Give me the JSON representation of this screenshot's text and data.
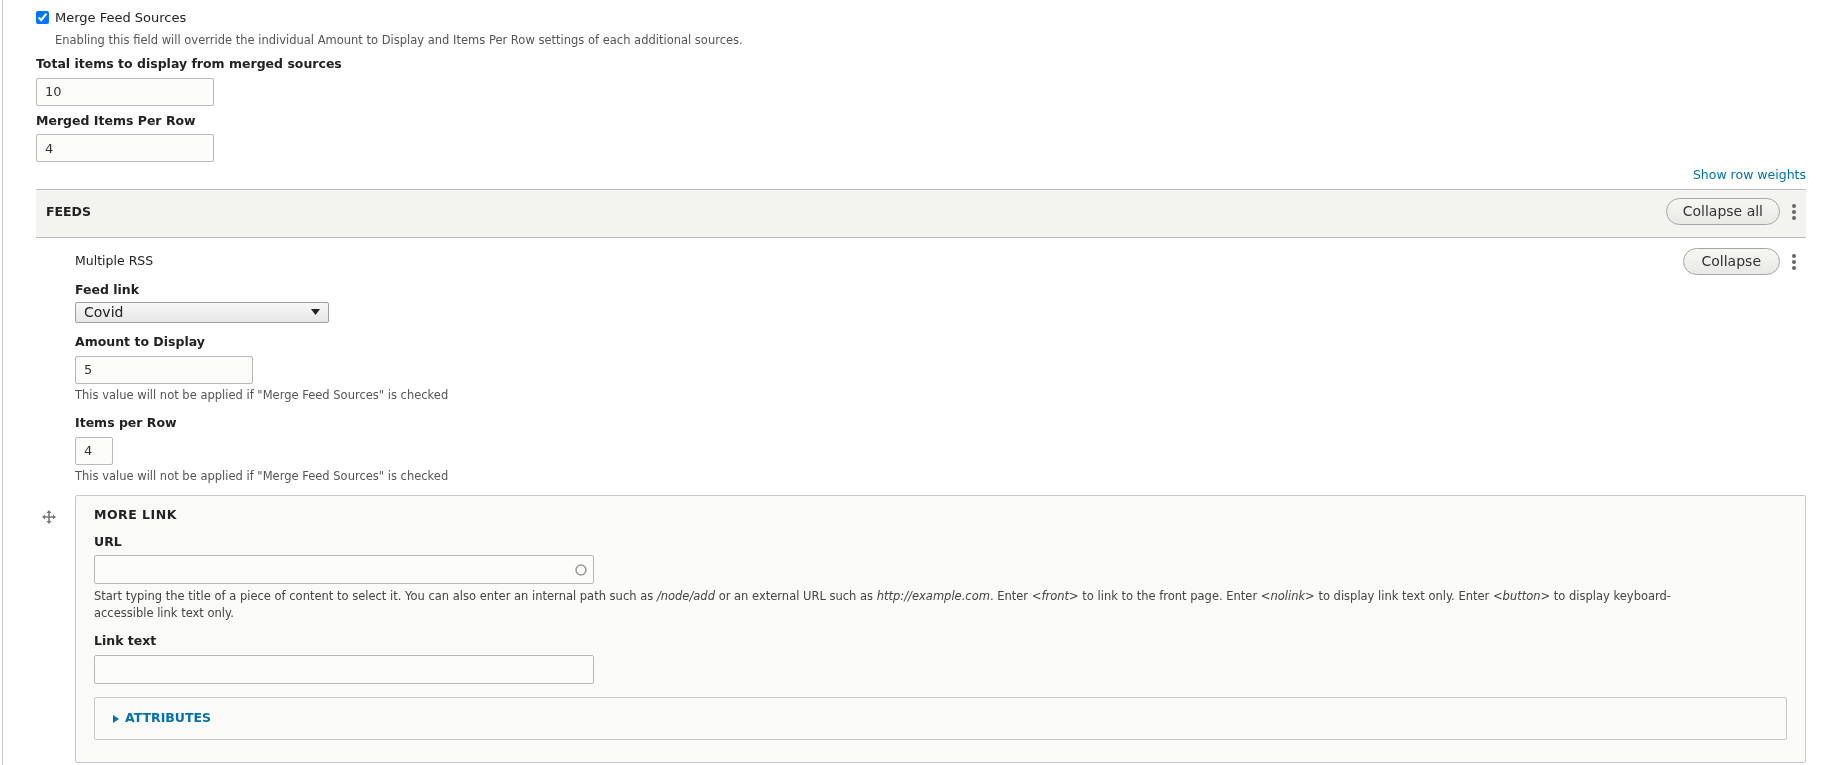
{
  "merge": {
    "label": "Merge Feed Sources",
    "checked": true,
    "description": "Enabling this field will override the individual Amount to Display and Items Per Row settings of each additional sources."
  },
  "merged_fields": [
    {
      "label": "Total items to display from merged sources",
      "value": "10"
    },
    {
      "label": "Merged Items Per Row",
      "value": "4"
    }
  ],
  "show_row_weights": "Show row weights",
  "feeds": {
    "title": "FEEDS",
    "collapse_all": "Collapse all",
    "item": {
      "title": "Multiple RSS",
      "collapse": "Collapse",
      "feed_link": {
        "label": "Feed link",
        "value": "Covid"
      },
      "amount": {
        "label": "Amount to Display",
        "value": "5",
        "help": "This value will not be applied if \"Merge Feed Sources\" is checked"
      },
      "per_row": {
        "label": "Items per Row",
        "value": "4",
        "help": "This value will not be applied if \"Merge Feed Sources\" is checked"
      },
      "more_link": {
        "title": "MORE LINK",
        "url": {
          "label": "URL",
          "help": "Start typing the title of a piece of content to select it. You can also enter an internal path such as */node/add* or an external URL such as *http://example.com*. Enter *<front>* to link to the front page. Enter *<nolink>* to display link text only. Enter *<button>* to display keyboard-accessible link text only."
        },
        "link_text": {
          "label": "Link text"
        },
        "attributes": {
          "label": "ATTRIBUTES",
          "expanded": false
        }
      }
    }
  }
}
